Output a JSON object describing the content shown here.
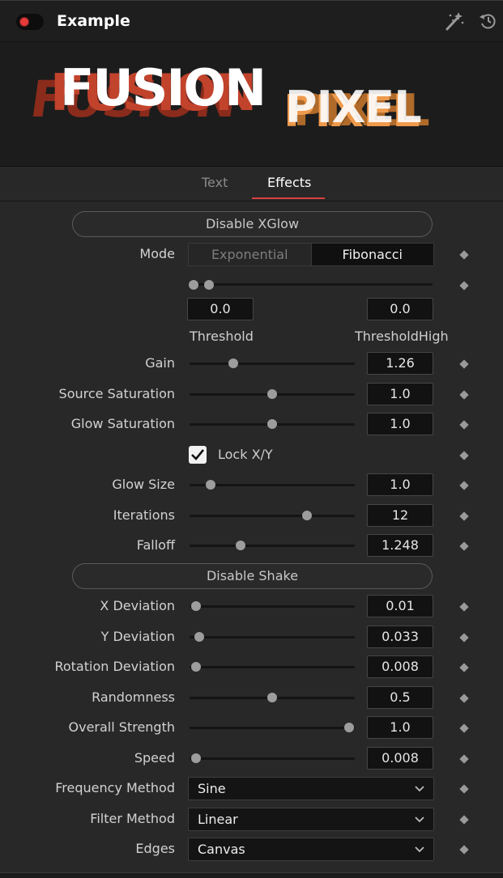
{
  "header": {
    "title": "Example"
  },
  "tabs": [
    {
      "label": "Text"
    },
    {
      "label": "Effects"
    }
  ],
  "xglow": {
    "section_button": "Disable XGlow",
    "mode_label": "Mode",
    "mode_options": [
      "Exponential",
      "Fibonacci"
    ],
    "mode_selected": "Fibonacci",
    "threshold_value": "0.0",
    "threshold_high_value": "0.0",
    "threshold_label": "Threshold",
    "threshold_high_label": "ThresholdHigh",
    "gain": {
      "label": "Gain",
      "value": "1.26"
    },
    "source_saturation": {
      "label": "Source Saturation",
      "value": "1.0"
    },
    "glow_saturation": {
      "label": "Glow Saturation",
      "value": "1.0"
    },
    "lock_xy": {
      "label": "Lock X/Y",
      "checked": true
    },
    "glow_size": {
      "label": "Glow Size",
      "value": "1.0"
    },
    "iterations": {
      "label": "Iterations",
      "value": "12"
    },
    "falloff": {
      "label": "Falloff",
      "value": "1.248"
    }
  },
  "shake": {
    "section_button": "Disable Shake",
    "x_deviation": {
      "label": "X Deviation",
      "value": "0.01"
    },
    "y_deviation": {
      "label": "Y Deviation",
      "value": "0.033"
    },
    "rotation_deviation": {
      "label": "Rotation Deviation",
      "value": "0.008"
    },
    "randomness": {
      "label": "Randomness",
      "value": "0.5"
    },
    "overall_strength": {
      "label": "Overall Strength",
      "value": "1.0"
    },
    "speed": {
      "label": "Speed",
      "value": "0.008"
    },
    "frequency_method": {
      "label": "Frequency Method",
      "value": "Sine"
    },
    "filter_method": {
      "label": "Filter Method",
      "value": "Linear"
    },
    "edges": {
      "label": "Edges",
      "value": "Canvas"
    }
  },
  "colors": {
    "accent": "#d9413f",
    "record_dot": "#e43a3a",
    "logo_red": "#c2432c",
    "logo_orange": "#ee9a4c"
  },
  "logo": {
    "word1": "FUSION",
    "word2": "PIXEL"
  }
}
